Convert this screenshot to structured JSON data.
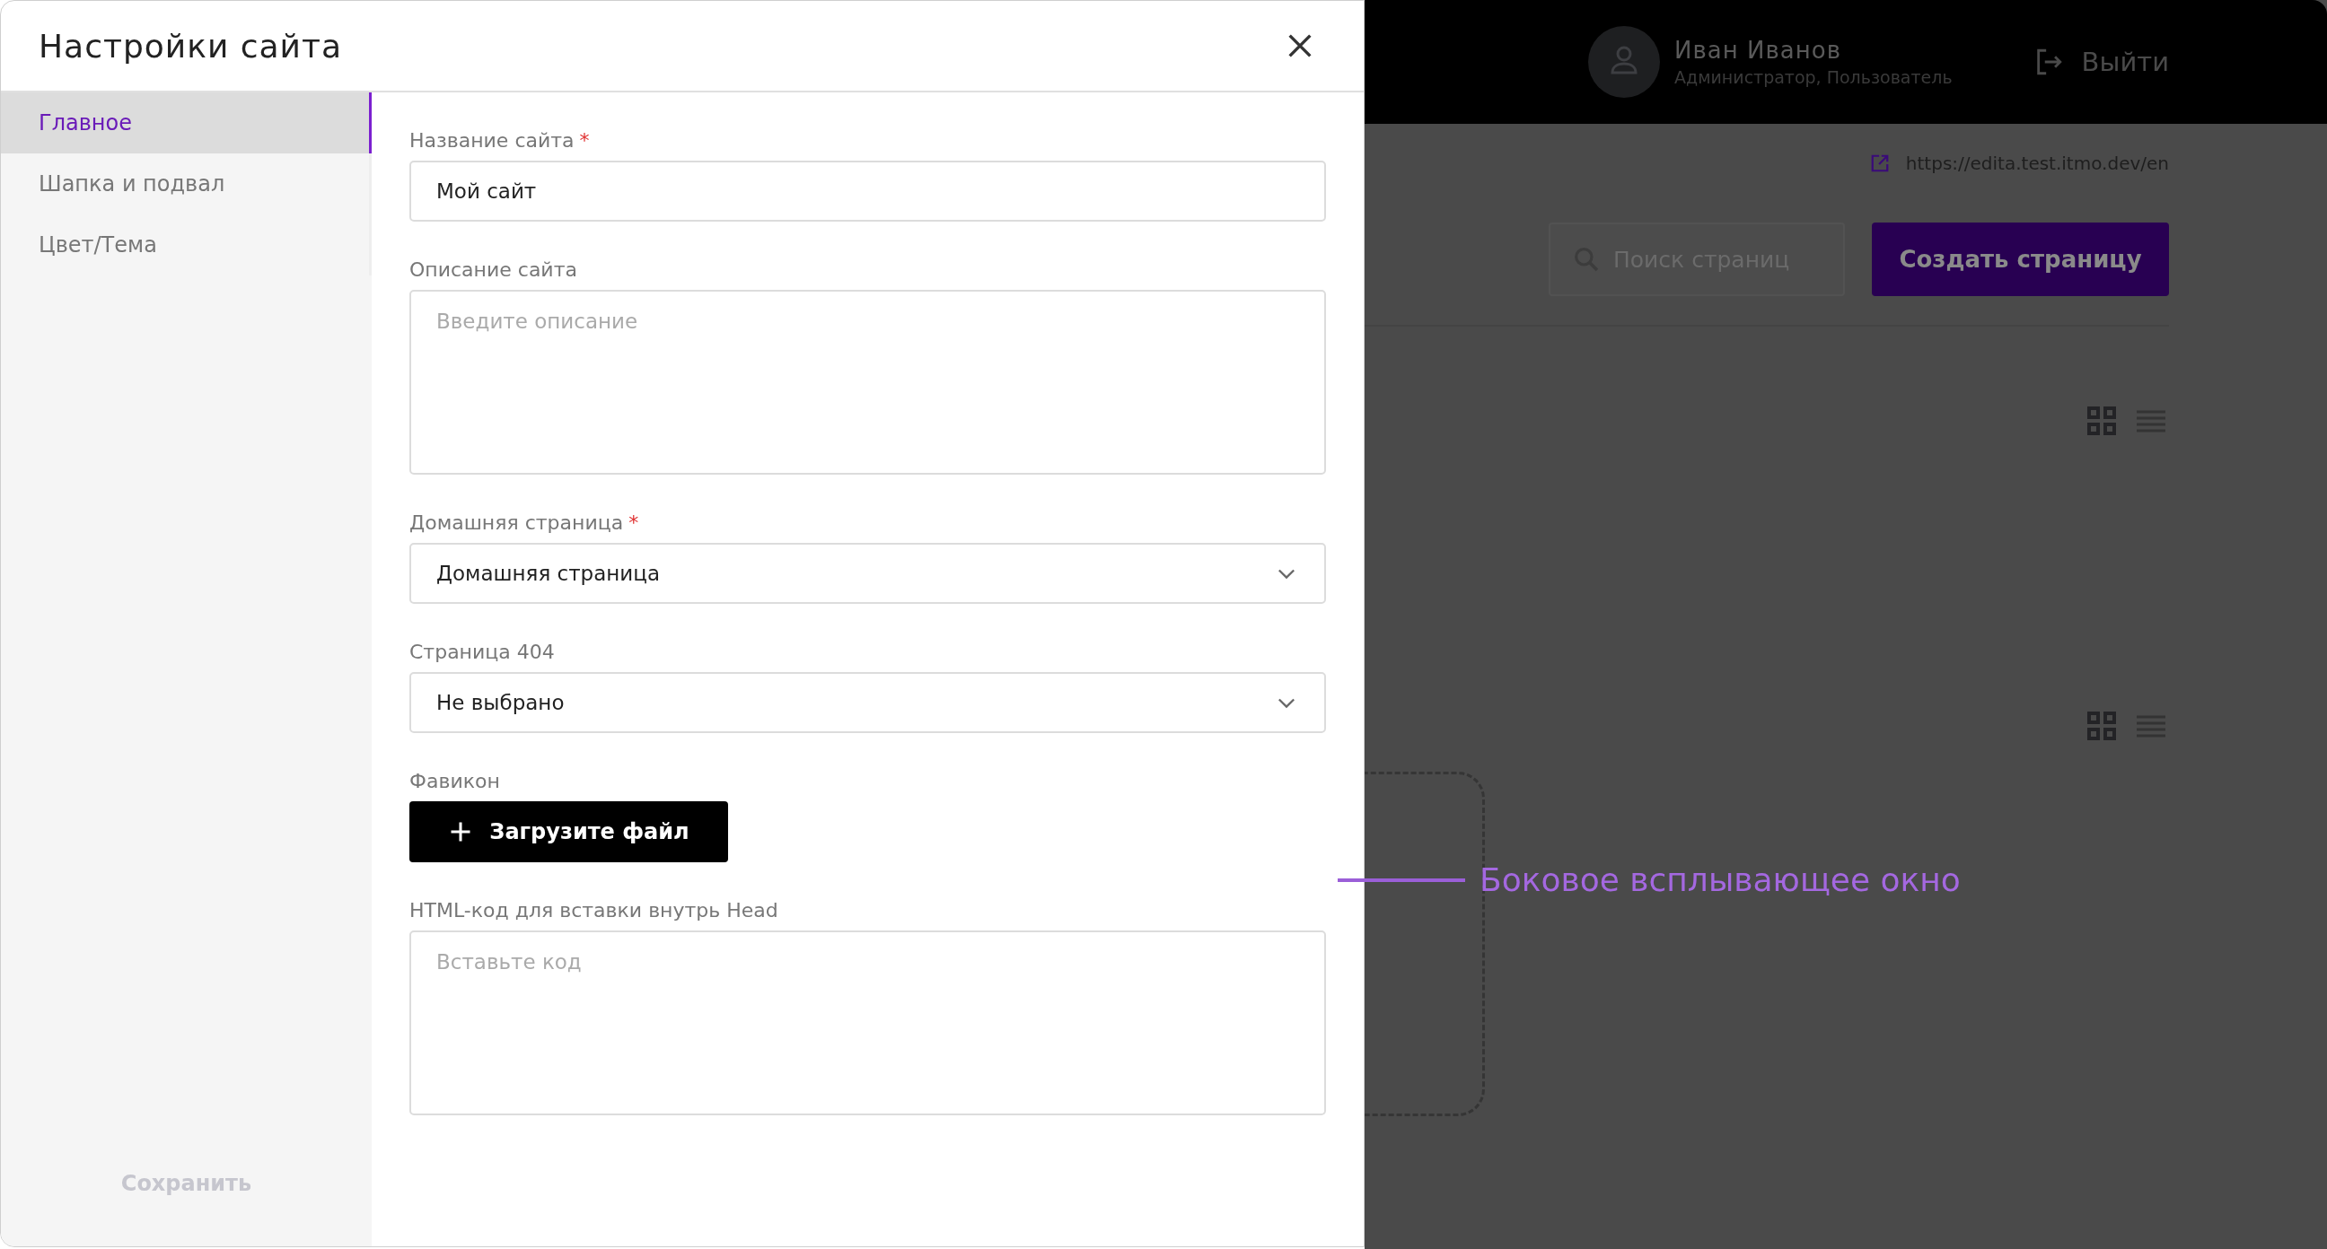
{
  "dialog": {
    "title": "Настройки сайта",
    "nav": [
      {
        "label": "Главное",
        "selected": true
      },
      {
        "label": "Шапка и подвал",
        "selected": false
      },
      {
        "label": "Цвет/Тема",
        "selected": false
      }
    ],
    "save_button": {
      "label": "Сохранить",
      "disabled": true
    },
    "fields": [
      {
        "kind": "input",
        "label": "Название сайта",
        "mark": "*",
        "value": "Мой сайт"
      },
      {
        "kind": "textarea",
        "label": "Описание сайта",
        "placeholder": "Введите описание"
      },
      {
        "kind": "select",
        "label": "Домашняя страница",
        "mark": "*",
        "value": "Домашняя страница"
      },
      {
        "kind": "select",
        "label": "Страница 404",
        "value": "Не выбрано"
      },
      {
        "kind": "upload",
        "label": "Фавикон",
        "button": "Загрузите файл"
      },
      {
        "kind": "textarea",
        "label": "HTML-код для вставки внутрь Head",
        "placeholder": "Вставьте код"
      }
    ]
  },
  "background_page": {
    "user": {
      "name": "Иван Иванов",
      "roles": "Администратор, Пользователь"
    },
    "logout": "Выйти",
    "site_url": "https://edita.test.itmo.dev/en",
    "search": {
      "placeholder": "Поиск страниц"
    },
    "create_button": "Создать страницу"
  },
  "annotation": {
    "text": "Боковое всплывающее окно"
  }
}
